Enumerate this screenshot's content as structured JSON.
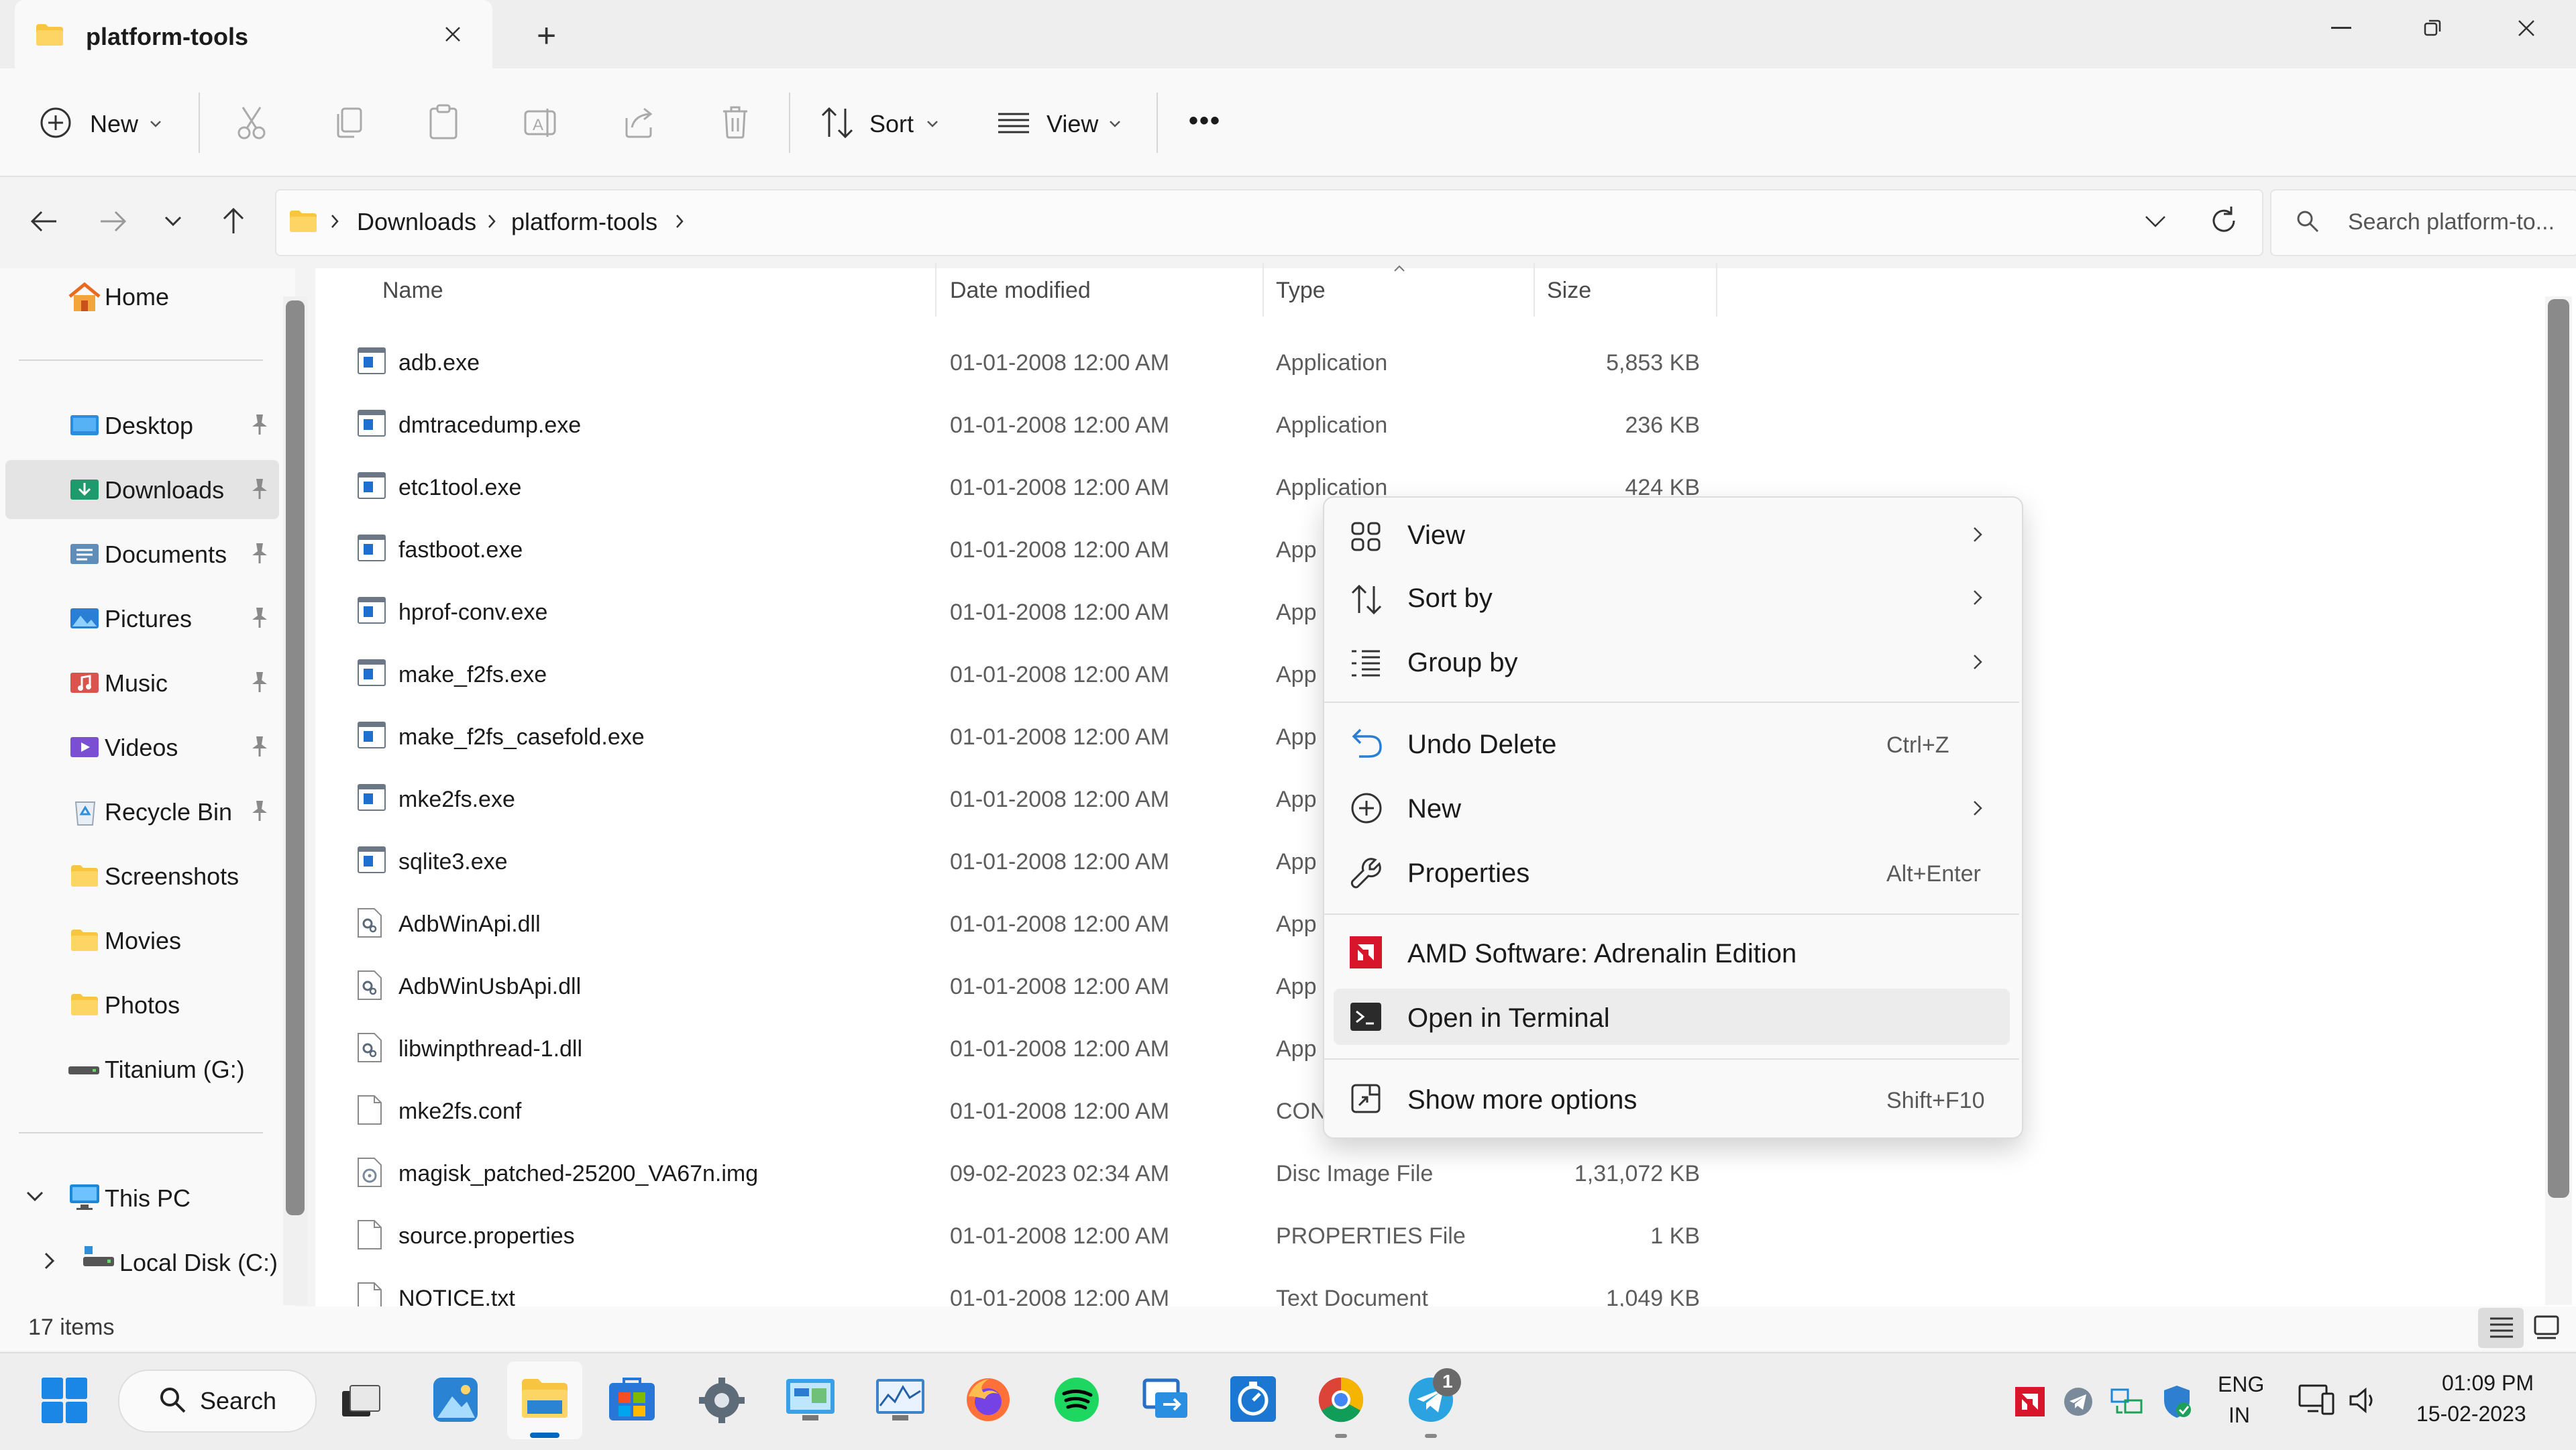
{
  "titlebar": {
    "tab_title": "platform-tools",
    "new_tab": "+"
  },
  "toolbar": {
    "new_label": "New",
    "sort_label": "Sort",
    "view_label": "View",
    "more_label": "•••"
  },
  "addressbar": {
    "crumbs": [
      "Downloads",
      "platform-tools"
    ],
    "search_placeholder": "Search platform-to..."
  },
  "sidebar": {
    "home": "Home",
    "quick": [
      {
        "label": "Desktop",
        "pinned": true
      },
      {
        "label": "Downloads",
        "pinned": true
      },
      {
        "label": "Documents",
        "pinned": true
      },
      {
        "label": "Pictures",
        "pinned": true
      },
      {
        "label": "Music",
        "pinned": true
      },
      {
        "label": "Videos",
        "pinned": true
      },
      {
        "label": "Recycle Bin",
        "pinned": true
      },
      {
        "label": "Screenshots",
        "pinned": false
      },
      {
        "label": "Movies",
        "pinned": false
      },
      {
        "label": "Photos",
        "pinned": false
      },
      {
        "label": "Titanium (G:)",
        "pinned": false
      }
    ],
    "this_pc": "This PC",
    "local_disk": "Local Disk (C:)"
  },
  "columns": {
    "name": "Name",
    "date": "Date modified",
    "type": "Type",
    "size": "Size"
  },
  "files": [
    {
      "name": "adb.exe",
      "date": "01-01-2008 12:00 AM",
      "type": "Application",
      "size": "5,853 KB",
      "kind": "exe"
    },
    {
      "name": "dmtracedump.exe",
      "date": "01-01-2008 12:00 AM",
      "type": "Application",
      "size": "236 KB",
      "kind": "exe"
    },
    {
      "name": "etc1tool.exe",
      "date": "01-01-2008 12:00 AM",
      "type": "Application",
      "size": "424 KB",
      "kind": "exe"
    },
    {
      "name": "fastboot.exe",
      "date": "01-01-2008 12:00 AM",
      "type": "App",
      "size": "",
      "kind": "exe"
    },
    {
      "name": "hprof-conv.exe",
      "date": "01-01-2008 12:00 AM",
      "type": "App",
      "size": "",
      "kind": "exe"
    },
    {
      "name": "make_f2fs.exe",
      "date": "01-01-2008 12:00 AM",
      "type": "App",
      "size": "",
      "kind": "exe"
    },
    {
      "name": "make_f2fs_casefold.exe",
      "date": "01-01-2008 12:00 AM",
      "type": "App",
      "size": "",
      "kind": "exe"
    },
    {
      "name": "mke2fs.exe",
      "date": "01-01-2008 12:00 AM",
      "type": "App",
      "size": "",
      "kind": "exe"
    },
    {
      "name": "sqlite3.exe",
      "date": "01-01-2008 12:00 AM",
      "type": "App",
      "size": "",
      "kind": "exe"
    },
    {
      "name": "AdbWinApi.dll",
      "date": "01-01-2008 12:00 AM",
      "type": "App",
      "size": "",
      "kind": "dll"
    },
    {
      "name": "AdbWinUsbApi.dll",
      "date": "01-01-2008 12:00 AM",
      "type": "App",
      "size": "",
      "kind": "dll"
    },
    {
      "name": "libwinpthread-1.dll",
      "date": "01-01-2008 12:00 AM",
      "type": "App",
      "size": "",
      "kind": "dll"
    },
    {
      "name": "mke2fs.conf",
      "date": "01-01-2008 12:00 AM",
      "type": "CON",
      "size": "",
      "kind": "file"
    },
    {
      "name": "magisk_patched-25200_VA67n.img",
      "date": "09-02-2023 02:34 AM",
      "type": "Disc Image File",
      "size": "1,31,072 KB",
      "kind": "img"
    },
    {
      "name": "source.properties",
      "date": "01-01-2008 12:00 AM",
      "type": "PROPERTIES File",
      "size": "1 KB",
      "kind": "file"
    },
    {
      "name": "NOTICE.txt",
      "date": "01-01-2008 12:00 AM",
      "type": "Text Document",
      "size": "1,049 KB",
      "kind": "file"
    }
  ],
  "status": {
    "items": "17 items"
  },
  "context_menu": {
    "items": [
      {
        "label": "View",
        "shortcut": "",
        "submenu": true,
        "icon": "view-grid-icon"
      },
      {
        "label": "Sort by",
        "shortcut": "",
        "submenu": true,
        "icon": "sort-icon"
      },
      {
        "label": "Group by",
        "shortcut": "",
        "submenu": true,
        "icon": "group-icon"
      },
      {
        "label": "Undo Delete",
        "shortcut": "Ctrl+Z",
        "submenu": false,
        "icon": "undo-icon"
      },
      {
        "label": "New",
        "shortcut": "",
        "submenu": true,
        "icon": "new-icon"
      },
      {
        "label": "Properties",
        "shortcut": "Alt+Enter",
        "submenu": false,
        "icon": "wrench-icon"
      },
      {
        "label": "AMD Software: Adrenalin Edition",
        "shortcut": "",
        "submenu": false,
        "icon": "amd-icon"
      },
      {
        "label": "Open in Terminal",
        "shortcut": "",
        "submenu": false,
        "icon": "terminal-icon"
      },
      {
        "label": "Show more options",
        "shortcut": "Shift+F10",
        "submenu": false,
        "icon": "more-options-icon"
      }
    ]
  },
  "taskbar": {
    "search_label": "Search",
    "lang_top": "ENG",
    "lang_bottom": "IN",
    "time": "01:09 PM",
    "date": "15-02-2023",
    "telegram_badge": "1"
  },
  "colors": {
    "accent": "#0067c0",
    "folder": "#f8c541",
    "selected": "#e4e4e4",
    "menu_bg": "#f9f9f9"
  }
}
